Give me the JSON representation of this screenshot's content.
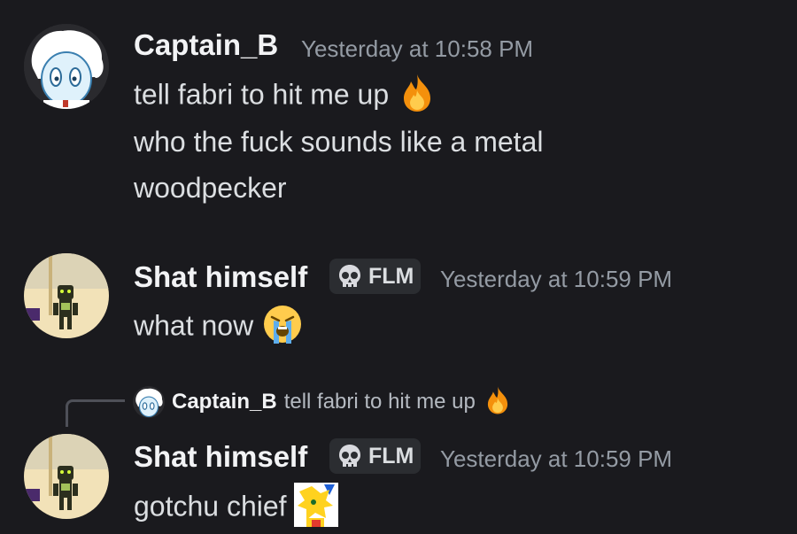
{
  "messages": [
    {
      "author": "Captain_B",
      "timestamp": "Yesterday at 10:58 PM",
      "lines": [
        "tell fabri to hit me up",
        "who the fuck sounds like a metal",
        "woodpecker"
      ],
      "emoji": [
        "fire-emoji"
      ]
    },
    {
      "author": "Shat himself",
      "tag": "FLM",
      "tag_icon": "skull-icon",
      "timestamp": "Yesterday at 10:59 PM",
      "lines": [
        "what now"
      ],
      "emoji": [
        "loudly-crying-emoji"
      ]
    },
    {
      "reply": {
        "author": "Captain_B",
        "text": "tell fabri to hit me up",
        "emoji": "fire-emoji"
      },
      "author": "Shat himself",
      "tag": "FLM",
      "tag_icon": "skull-icon",
      "timestamp": "Yesterday at 10:59 PM",
      "lines": [
        "gotchu chief"
      ],
      "emoji": [
        "sonic-sticker-emoji"
      ]
    }
  ],
  "colors": {
    "background": "#1a1a1e",
    "name": "#f2f3f5",
    "text": "#dbdee1",
    "timestamp": "#949ba4",
    "tag_bg": "#2b2d31"
  }
}
